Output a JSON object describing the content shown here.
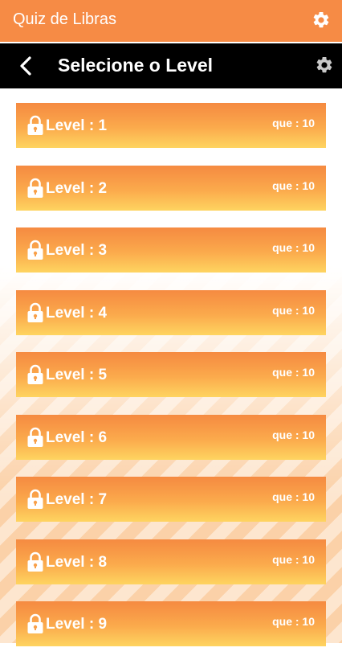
{
  "app": {
    "title": "Quiz de Libras",
    "settings_icon": "gear-icon"
  },
  "toolbar": {
    "title": "Selecione o Level",
    "back_icon": "chevron-left-icon",
    "settings_icon": "gear-icon"
  },
  "colors": {
    "appbar": "#f68b45",
    "toolbar": "#000000",
    "card_top": "#f58a41",
    "card_bottom": "#fed460"
  },
  "levels": [
    {
      "label": "Level : 1",
      "questions": "que : 10",
      "icon": "lock-icon"
    },
    {
      "label": "Level : 2",
      "questions": "que : 10",
      "icon": "lock-icon"
    },
    {
      "label": "Level : 3",
      "questions": "que : 10",
      "icon": "lock-icon"
    },
    {
      "label": "Level : 4",
      "questions": "que : 10",
      "icon": "lock-icon"
    },
    {
      "label": "Level : 5",
      "questions": "que : 10",
      "icon": "lock-icon"
    },
    {
      "label": "Level : 6",
      "questions": "que : 10",
      "icon": "lock-icon"
    },
    {
      "label": "Level : 7",
      "questions": "que : 10",
      "icon": "lock-icon"
    },
    {
      "label": "Level : 8",
      "questions": "que : 10",
      "icon": "lock-icon"
    },
    {
      "label": "Level : 9",
      "questions": "que : 10",
      "icon": "lock-icon"
    }
  ]
}
